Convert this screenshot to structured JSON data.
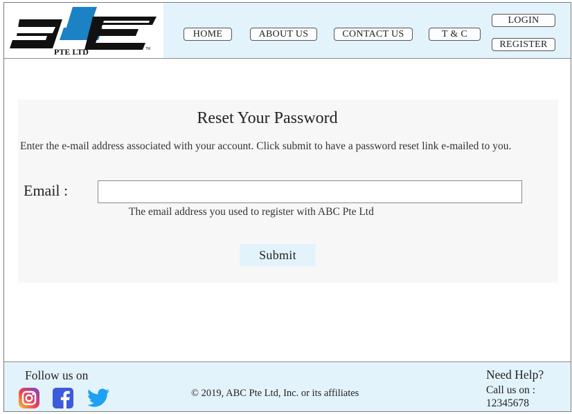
{
  "brand": {
    "logo_text": "PTE LTD",
    "logo_tm": "TM"
  },
  "nav": {
    "home": "HOME",
    "about": "ABOUT US",
    "contact": "CONTACT US",
    "tc": "T & C",
    "login": "LOGIN",
    "register": "REGISTER"
  },
  "form": {
    "title": "Reset Your Password",
    "description": "Enter the e-mail address associated with your account. Click submit to have a password reset link e-mailed to you.",
    "email_label": "Email :",
    "email_value": "",
    "email_hint": "The email address you used to register with ABC Pte Ltd",
    "submit_label": "Submit"
  },
  "footer": {
    "follow_label": "Follow us on",
    "social": [
      "instagram-icon",
      "facebook-icon",
      "twitter-icon"
    ],
    "copyright": "© 2019, ABC Pte Ltd, Inc. or its affiliates",
    "help_title": "Need Help?",
    "call_label": "Call us on :",
    "phone": "12345678"
  },
  "colors": {
    "header_bg": "#e3f3fb",
    "logo_blue": "#1b82c5",
    "logo_black": "#111111",
    "card_bg": "#f7f7f7",
    "facebook": "#3b5bdb",
    "twitter": "#1da1f2"
  }
}
